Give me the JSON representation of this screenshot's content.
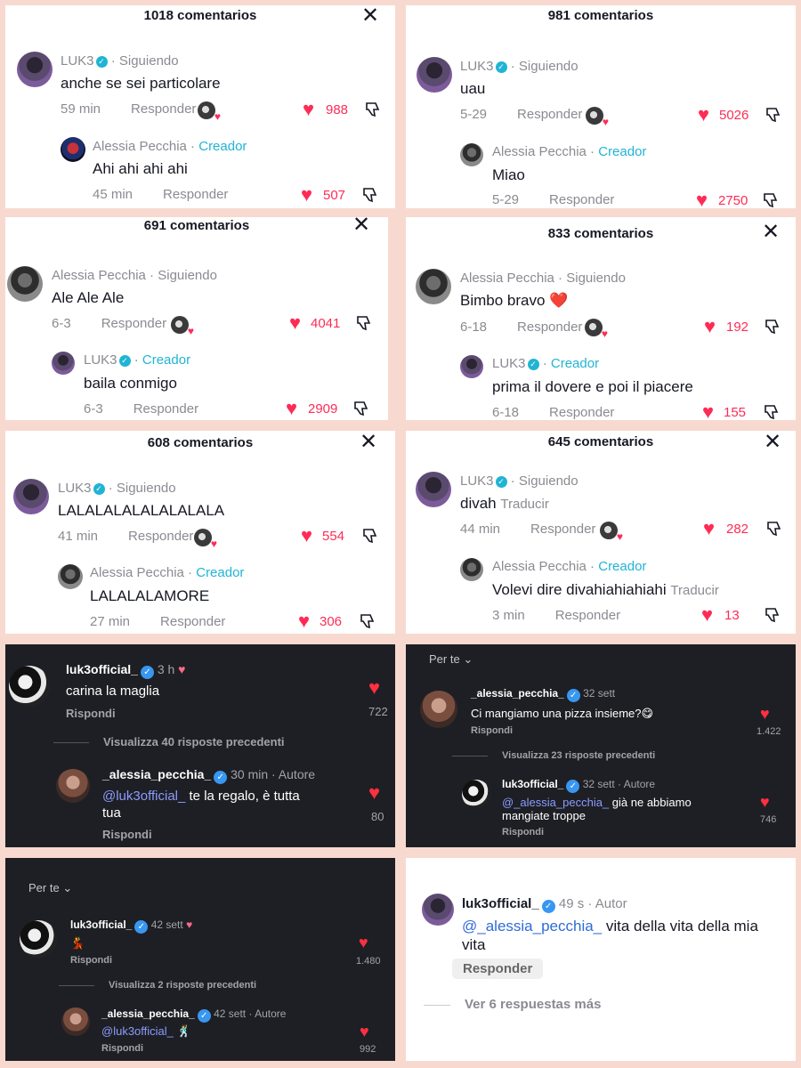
{
  "panels": [
    {
      "header": "1018 comentarios",
      "main": {
        "user": "LUK3",
        "sep": " · ",
        "status": "Siguiendo",
        "text": "anche se sei particolare",
        "time": "59 min",
        "reply": "Responder",
        "likes": "988"
      },
      "reply": {
        "user": "Alessia Pecchia",
        "sep": " · ",
        "role": "Creador",
        "text": "Ahi ahi ahi ahi",
        "time": "45 min",
        "reply": "Responder",
        "likes": "507"
      }
    },
    {
      "header": "981 comentarios",
      "main": {
        "user": "LUK3",
        "sep": " · ",
        "status": "Siguiendo",
        "text": "uau",
        "time": "5-29",
        "reply": "Responder",
        "likes": "5026"
      },
      "reply": {
        "user": "Alessia Pecchia",
        "sep": " · ",
        "role": "Creador",
        "text": "Miao",
        "time": "5-29",
        "reply": "Responder",
        "likes": "2750"
      }
    },
    {
      "header": "691 comentarios",
      "main": {
        "user": "Alessia Pecchia",
        "sep": " · ",
        "status": "Siguiendo",
        "text": "Ale Ale Ale",
        "time": "6-3",
        "reply": "Responder",
        "likes": "4041"
      },
      "reply": {
        "user": "LUK3",
        "sep": " · ",
        "role": "Creador",
        "text": "baila conmigo",
        "time": "6-3",
        "reply": "Responder",
        "likes": "2909"
      }
    },
    {
      "header": "833 comentarios",
      "main": {
        "user": "Alessia Pecchia",
        "sep": " · ",
        "status": "Siguiendo",
        "text": "Bimbo bravo ❤️",
        "time": "6-18",
        "reply": "Responder",
        "likes": "192"
      },
      "reply": {
        "user": "LUK3",
        "sep": " · ",
        "role": "Creador",
        "text": "prima il dovere e poi il piacere",
        "time": "6-18",
        "reply": "Responder",
        "likes": "155"
      }
    },
    {
      "header": "608 comentarios",
      "main": {
        "user": "LUK3",
        "sep": " · ",
        "status": "Siguiendo",
        "text": "LALALALALALALALALA",
        "time": "41 min",
        "reply": "Responder",
        "likes": "554"
      },
      "reply": {
        "user": "Alessia Pecchia",
        "sep": " · ",
        "role": "Creador",
        "text": "LALALALAMORE",
        "time": "27 min",
        "reply": "Responder",
        "likes": "306"
      }
    },
    {
      "header": "645 comentarios",
      "main": {
        "user": "LUK3",
        "sep": " · ",
        "status": "Siguiendo",
        "text": "divah",
        "translate": "Traducir",
        "time": "44 min",
        "reply": "Responder",
        "likes": "282"
      },
      "reply": {
        "user": "Alessia Pecchia",
        "sep": " · ",
        "role": "Creador",
        "text": "Volevi dire divahiahiahiahi",
        "translate": "Traducir",
        "time": "3 min",
        "reply": "Responder",
        "likes": "13"
      }
    }
  ],
  "ig1": {
    "main": {
      "user": "luk3official_",
      "time": "3 h",
      "text": "carina la maglia",
      "reply": "Rispondi",
      "likes": "722"
    },
    "view": "Visualizza 40 risposte precedenti",
    "reply": {
      "user": "_alessia_pecchia_",
      "time": "30 min · Autore",
      "mention": "@luk3official_",
      "text": " te la regalo, è tutta",
      "text2": "tua",
      "reply": "Rispondi",
      "likes": "80"
    }
  },
  "ig2": {
    "filter": "Per te",
    "main": {
      "user": "_alessia_pecchia_",
      "time": "32 sett",
      "text": "Ci mangiamo una pizza insieme?😋",
      "reply": "Rispondi",
      "likes": "1.422"
    },
    "view": "Visualizza 23 risposte precedenti",
    "reply": {
      "user": "luk3official_",
      "time": "32 sett · Autore",
      "mention": "@_alessia_pecchia_",
      "text": " già ne abbiamo",
      "text2": "mangiate troppe",
      "reply": "Rispondi",
      "likes": "746"
    }
  },
  "ig3": {
    "filter": "Per te",
    "main": {
      "user": "luk3official_",
      "time": "42 sett",
      "text": "💃",
      "reply": "Rispondi",
      "likes": "1.480"
    },
    "view": "Visualizza 2 risposte precedenti",
    "reply": {
      "user": "_alessia_pecchia_",
      "time": "42 sett · Autore",
      "mention": "@luk3official_",
      "text": " 🕺",
      "reply": "Rispondi",
      "likes": "992"
    }
  },
  "ig4": {
    "user": "luk3official_",
    "time": "49 s · Autor",
    "mention": "@_alessia_pecchia_",
    "text": " vita della vita della mia",
    "text2": "vita",
    "reply": "Responder",
    "more": "Ver 6 respuestas más"
  }
}
